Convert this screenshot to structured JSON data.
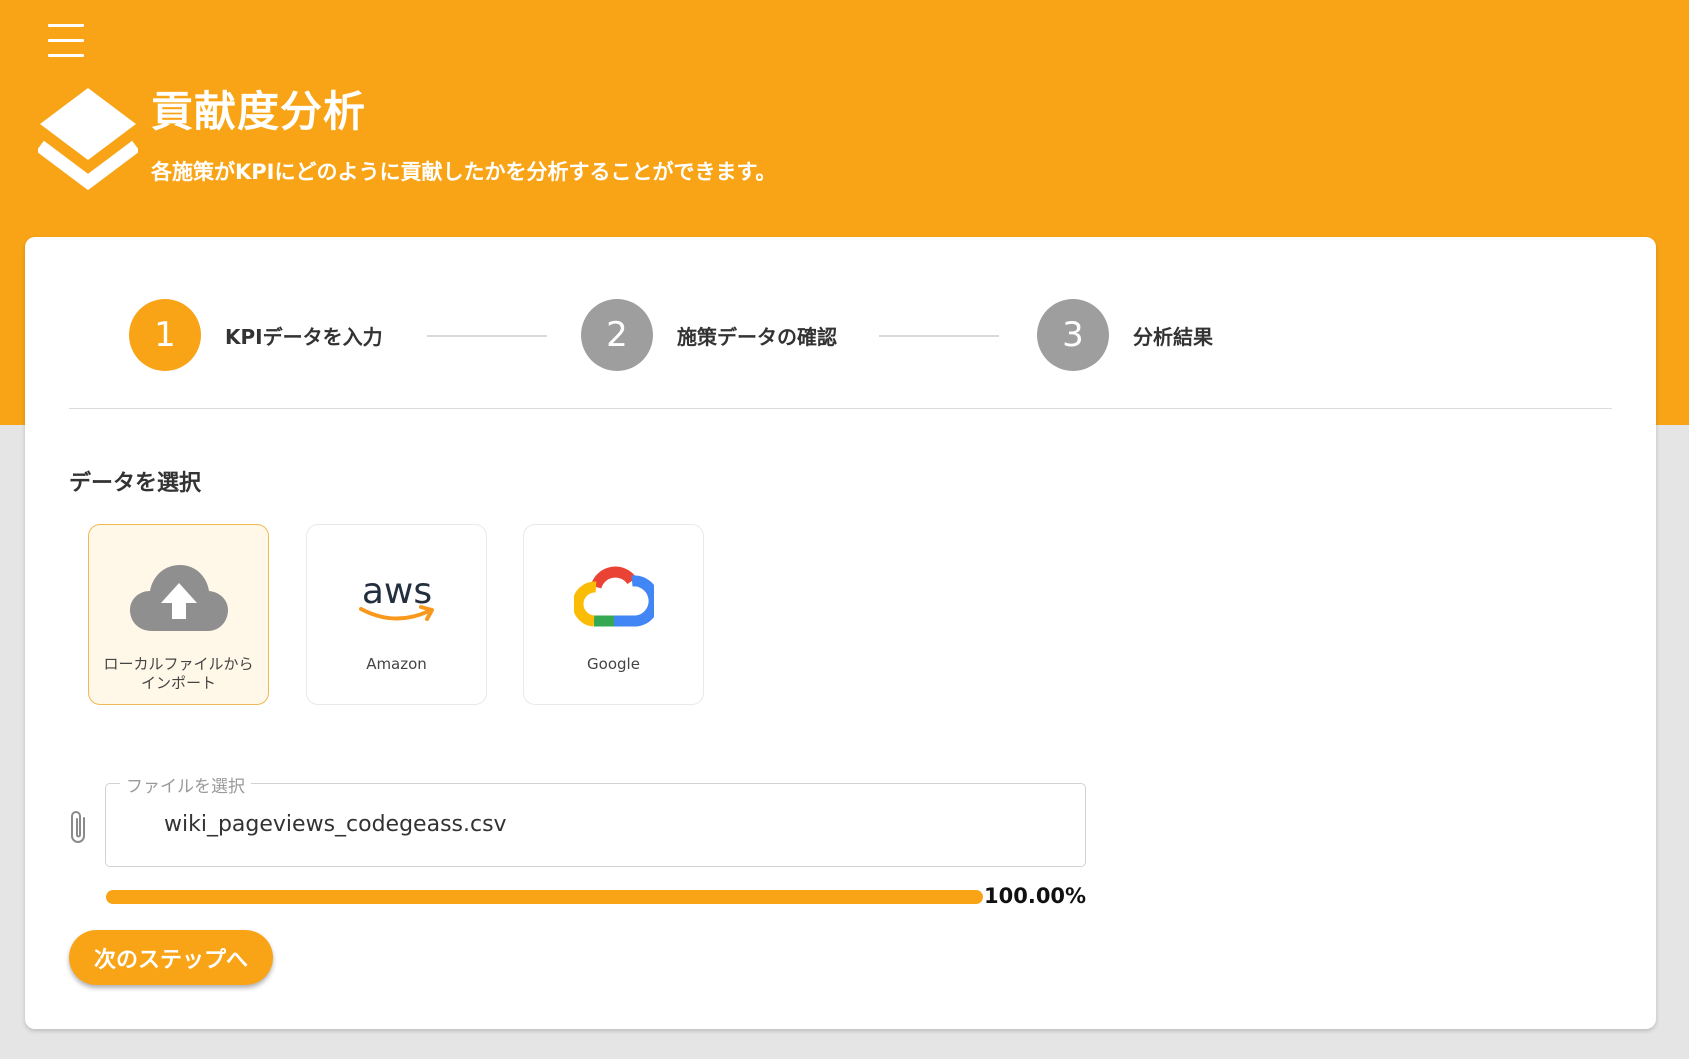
{
  "header": {
    "title": "貢献度分析",
    "subtitle": "各施策がKPIにどのように貢献したかを分析することができます。",
    "menu_icon": "menu-icon",
    "logo_icon": "layers-icon"
  },
  "stepper": {
    "active_step": 1,
    "steps": [
      {
        "number": "1",
        "label": "KPIデータを入力",
        "status": "active"
      },
      {
        "number": "2",
        "label": "施策データの確認",
        "status": "inactive"
      },
      {
        "number": "3",
        "label": "分析結果",
        "status": "inactive"
      }
    ]
  },
  "data_select": {
    "title": "データを選択",
    "sources": [
      {
        "label": "ローカルファイルからインポート",
        "icon": "cloud-upload-icon",
        "selected": true
      },
      {
        "label": "Amazon",
        "icon": "aws-logo-icon",
        "selected": false
      },
      {
        "label": "Google",
        "icon": "google-cloud-logo-icon",
        "selected": false
      }
    ]
  },
  "file_input": {
    "legend": "ファイルを選択",
    "value": "wiki_pageviews_codegeass.csv",
    "icon": "paperclip-icon"
  },
  "progress": {
    "value": 100,
    "text": "100.00%"
  },
  "next_button": {
    "label": "次のステップへ"
  },
  "colors": {
    "accent": "#f8a416",
    "step_inactive": "#9e9e9e",
    "background": "#e5e5e5",
    "card": "#ffffff"
  },
  "aws_logo_text": "aws"
}
